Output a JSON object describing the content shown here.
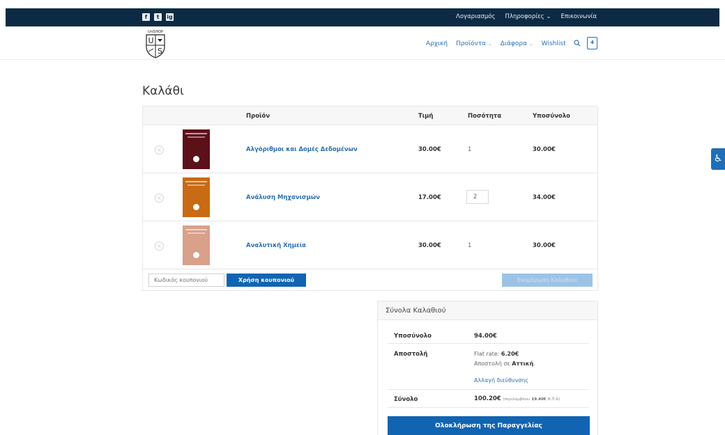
{
  "topbar": {
    "social": [
      "f",
      "t",
      "ig"
    ],
    "links": [
      {
        "label": "Λογαριασμός"
      },
      {
        "label": "Πληροφορίες ⌄"
      },
      {
        "label": "Επικοινωνία"
      }
    ]
  },
  "logo": {
    "text": "UniSHOP",
    "letters": [
      "U",
      "S"
    ]
  },
  "nav": {
    "items": [
      {
        "label": "Αρχική"
      },
      {
        "label": "Προϊόντα"
      },
      {
        "label": "Διάφορα"
      },
      {
        "label": "Wishlist"
      }
    ],
    "cart_count": "4"
  },
  "page_title": "Καλάθι",
  "table": {
    "headers": {
      "product": "Προϊόν",
      "price": "Τιμή",
      "quantity": "Ποσότητα",
      "subtotal": "Υποσύνολο"
    },
    "rows": [
      {
        "name": "Αλγόριθμοι και Δομές Δεδομένων",
        "price": "30.00€",
        "qty": "1",
        "subtotal": "30.00€",
        "cover_color": "#5c1018"
      },
      {
        "name": "Ανάλυση Μηχανισμών",
        "price": "17.00€",
        "qty": "2",
        "subtotal": "34.00€",
        "cover_color": "#c96a14"
      },
      {
        "name": "Αναλυτική Χημεία",
        "price": "30.00€",
        "qty": "1",
        "subtotal": "30.00€",
        "cover_color": "#d9a08a"
      }
    ],
    "remove_glyph": "×"
  },
  "actions": {
    "coupon_placeholder": "Κωδικός κουπονιού",
    "coupon_button": "Χρήση κουπονιού",
    "update_button": "Ενημέρωση Καλαθιού"
  },
  "totals": {
    "title": "Σύνολα Καλαθιού",
    "subtotal_label": "Υποσύνολο",
    "subtotal_value": "94.00€",
    "shipping_label": "Αποστολή",
    "shipping_rate_prefix": "Flat rate: ",
    "shipping_rate": "6.20€",
    "shipping_to_prefix": "Αποστολή σε ",
    "shipping_to_region": "Αττική",
    "shipping_to_suffix": ".",
    "change_address": "Αλλαγή διεύθυνσης",
    "total_label": "Σύνολο",
    "total_value": "100.20€",
    "tax_note_prefix": "(περιλαμβάνει ",
    "tax_amount": "19.40€",
    "tax_note_suffix": " Φ.Π.Α)",
    "checkout_button": "Ολοκλήρωση της Παραγγελίας"
  },
  "accessibility_glyph": "♿",
  "colors": {
    "topbar": "#0d2a44",
    "accent": "#1164b2",
    "link": "#2d6fb3"
  }
}
